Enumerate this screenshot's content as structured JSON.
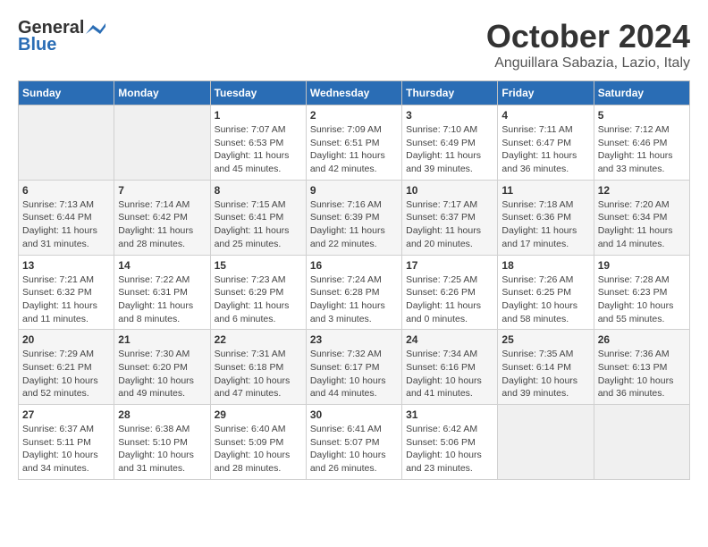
{
  "header": {
    "logo_general": "General",
    "logo_blue": "Blue",
    "month_title": "October 2024",
    "location": "Anguillara Sabazia, Lazio, Italy"
  },
  "weekdays": [
    "Sunday",
    "Monday",
    "Tuesday",
    "Wednesday",
    "Thursday",
    "Friday",
    "Saturday"
  ],
  "weeks": [
    [
      {
        "day": "",
        "empty": true
      },
      {
        "day": "",
        "empty": true
      },
      {
        "day": "1",
        "sunrise": "Sunrise: 7:07 AM",
        "sunset": "Sunset: 6:53 PM",
        "daylight": "Daylight: 11 hours and 45 minutes."
      },
      {
        "day": "2",
        "sunrise": "Sunrise: 7:09 AM",
        "sunset": "Sunset: 6:51 PM",
        "daylight": "Daylight: 11 hours and 42 minutes."
      },
      {
        "day": "3",
        "sunrise": "Sunrise: 7:10 AM",
        "sunset": "Sunset: 6:49 PM",
        "daylight": "Daylight: 11 hours and 39 minutes."
      },
      {
        "day": "4",
        "sunrise": "Sunrise: 7:11 AM",
        "sunset": "Sunset: 6:47 PM",
        "daylight": "Daylight: 11 hours and 36 minutes."
      },
      {
        "day": "5",
        "sunrise": "Sunrise: 7:12 AM",
        "sunset": "Sunset: 6:46 PM",
        "daylight": "Daylight: 11 hours and 33 minutes."
      }
    ],
    [
      {
        "day": "6",
        "sunrise": "Sunrise: 7:13 AM",
        "sunset": "Sunset: 6:44 PM",
        "daylight": "Daylight: 11 hours and 31 minutes."
      },
      {
        "day": "7",
        "sunrise": "Sunrise: 7:14 AM",
        "sunset": "Sunset: 6:42 PM",
        "daylight": "Daylight: 11 hours and 28 minutes."
      },
      {
        "day": "8",
        "sunrise": "Sunrise: 7:15 AM",
        "sunset": "Sunset: 6:41 PM",
        "daylight": "Daylight: 11 hours and 25 minutes."
      },
      {
        "day": "9",
        "sunrise": "Sunrise: 7:16 AM",
        "sunset": "Sunset: 6:39 PM",
        "daylight": "Daylight: 11 hours and 22 minutes."
      },
      {
        "day": "10",
        "sunrise": "Sunrise: 7:17 AM",
        "sunset": "Sunset: 6:37 PM",
        "daylight": "Daylight: 11 hours and 20 minutes."
      },
      {
        "day": "11",
        "sunrise": "Sunrise: 7:18 AM",
        "sunset": "Sunset: 6:36 PM",
        "daylight": "Daylight: 11 hours and 17 minutes."
      },
      {
        "day": "12",
        "sunrise": "Sunrise: 7:20 AM",
        "sunset": "Sunset: 6:34 PM",
        "daylight": "Daylight: 11 hours and 14 minutes."
      }
    ],
    [
      {
        "day": "13",
        "sunrise": "Sunrise: 7:21 AM",
        "sunset": "Sunset: 6:32 PM",
        "daylight": "Daylight: 11 hours and 11 minutes."
      },
      {
        "day": "14",
        "sunrise": "Sunrise: 7:22 AM",
        "sunset": "Sunset: 6:31 PM",
        "daylight": "Daylight: 11 hours and 8 minutes."
      },
      {
        "day": "15",
        "sunrise": "Sunrise: 7:23 AM",
        "sunset": "Sunset: 6:29 PM",
        "daylight": "Daylight: 11 hours and 6 minutes."
      },
      {
        "day": "16",
        "sunrise": "Sunrise: 7:24 AM",
        "sunset": "Sunset: 6:28 PM",
        "daylight": "Daylight: 11 hours and 3 minutes."
      },
      {
        "day": "17",
        "sunrise": "Sunrise: 7:25 AM",
        "sunset": "Sunset: 6:26 PM",
        "daylight": "Daylight: 11 hours and 0 minutes."
      },
      {
        "day": "18",
        "sunrise": "Sunrise: 7:26 AM",
        "sunset": "Sunset: 6:25 PM",
        "daylight": "Daylight: 10 hours and 58 minutes."
      },
      {
        "day": "19",
        "sunrise": "Sunrise: 7:28 AM",
        "sunset": "Sunset: 6:23 PM",
        "daylight": "Daylight: 10 hours and 55 minutes."
      }
    ],
    [
      {
        "day": "20",
        "sunrise": "Sunrise: 7:29 AM",
        "sunset": "Sunset: 6:21 PM",
        "daylight": "Daylight: 10 hours and 52 minutes."
      },
      {
        "day": "21",
        "sunrise": "Sunrise: 7:30 AM",
        "sunset": "Sunset: 6:20 PM",
        "daylight": "Daylight: 10 hours and 49 minutes."
      },
      {
        "day": "22",
        "sunrise": "Sunrise: 7:31 AM",
        "sunset": "Sunset: 6:18 PM",
        "daylight": "Daylight: 10 hours and 47 minutes."
      },
      {
        "day": "23",
        "sunrise": "Sunrise: 7:32 AM",
        "sunset": "Sunset: 6:17 PM",
        "daylight": "Daylight: 10 hours and 44 minutes."
      },
      {
        "day": "24",
        "sunrise": "Sunrise: 7:34 AM",
        "sunset": "Sunset: 6:16 PM",
        "daylight": "Daylight: 10 hours and 41 minutes."
      },
      {
        "day": "25",
        "sunrise": "Sunrise: 7:35 AM",
        "sunset": "Sunset: 6:14 PM",
        "daylight": "Daylight: 10 hours and 39 minutes."
      },
      {
        "day": "26",
        "sunrise": "Sunrise: 7:36 AM",
        "sunset": "Sunset: 6:13 PM",
        "daylight": "Daylight: 10 hours and 36 minutes."
      }
    ],
    [
      {
        "day": "27",
        "sunrise": "Sunrise: 6:37 AM",
        "sunset": "Sunset: 5:11 PM",
        "daylight": "Daylight: 10 hours and 34 minutes."
      },
      {
        "day": "28",
        "sunrise": "Sunrise: 6:38 AM",
        "sunset": "Sunset: 5:10 PM",
        "daylight": "Daylight: 10 hours and 31 minutes."
      },
      {
        "day": "29",
        "sunrise": "Sunrise: 6:40 AM",
        "sunset": "Sunset: 5:09 PM",
        "daylight": "Daylight: 10 hours and 28 minutes."
      },
      {
        "day": "30",
        "sunrise": "Sunrise: 6:41 AM",
        "sunset": "Sunset: 5:07 PM",
        "daylight": "Daylight: 10 hours and 26 minutes."
      },
      {
        "day": "31",
        "sunrise": "Sunrise: 6:42 AM",
        "sunset": "Sunset: 5:06 PM",
        "daylight": "Daylight: 10 hours and 23 minutes."
      },
      {
        "day": "",
        "empty": true
      },
      {
        "day": "",
        "empty": true
      }
    ]
  ]
}
